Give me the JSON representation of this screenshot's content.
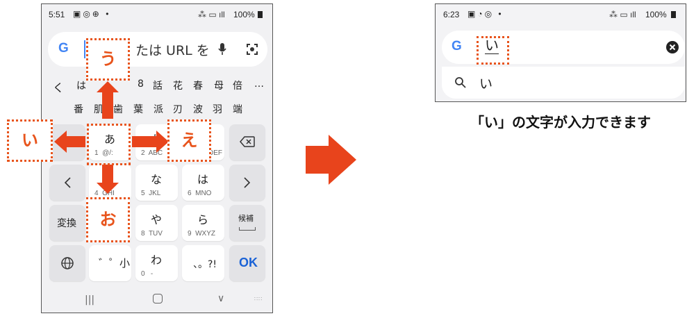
{
  "left_phone": {
    "status": {
      "time": "5:51",
      "battery": "100%"
    },
    "search": {
      "g_logo": "G",
      "placeholder_visible": "たは URL を",
      "mic_icon": "mic-icon",
      "lens_icon": "lens-icon"
    },
    "candidates_row1": {
      "back": "く",
      "items": [
        "は",
        "8",
        "話",
        "花",
        "春",
        "母",
        "倍"
      ],
      "more": "…"
    },
    "candidates_row2": {
      "items": [
        "番",
        "肌",
        "歯",
        "葉",
        "派",
        "刃",
        "波",
        "羽",
        "端"
      ]
    },
    "keys": {
      "a": {
        "main": "あ",
        "sub": "1  @/:"
      },
      "ka": {
        "main": "か",
        "sub": "2  ABC"
      },
      "sa": {
        "sub": "DEF"
      },
      "ta": {
        "sub": "4  GHI"
      },
      "na": {
        "main": "な",
        "sub": "5  JKL"
      },
      "ha": {
        "main": "は",
        "sub": "6  MNO"
      },
      "ya": {
        "main": "や",
        "sub": "8  TUV"
      },
      "ra": {
        "main": "ら",
        "sub": "9  WXYZ"
      },
      "wa": {
        "main": "わ",
        "sub": "0   -"
      },
      "dakuten": "゛゜小",
      "punct": "、。?!",
      "henkan": "変換",
      "kouho": "候補",
      "ok": "OK",
      "globe_icon": "globe-icon",
      "backspace_icon": "backspace-icon",
      "left_icon": "chevron-left-icon",
      "right_icon": "chevron-right-icon"
    },
    "nav": {
      "recent": "|||",
      "home": "○",
      "back": "∨"
    },
    "flick_labels": {
      "up": "う",
      "left": "い",
      "right": "え",
      "down": "お"
    }
  },
  "right_phone": {
    "status": {
      "time": "6:23",
      "battery": "100%"
    },
    "search": {
      "g_logo": "G",
      "input_value": "い",
      "clear_icon": "clear-icon"
    },
    "suggestion": {
      "icon": "search-icon",
      "text": "い"
    }
  },
  "caption": "「い」の文字が入力できます",
  "colors": {
    "accent": "#e8441c",
    "ok_blue": "#1a62d6",
    "google_blue": "#4285f4"
  }
}
